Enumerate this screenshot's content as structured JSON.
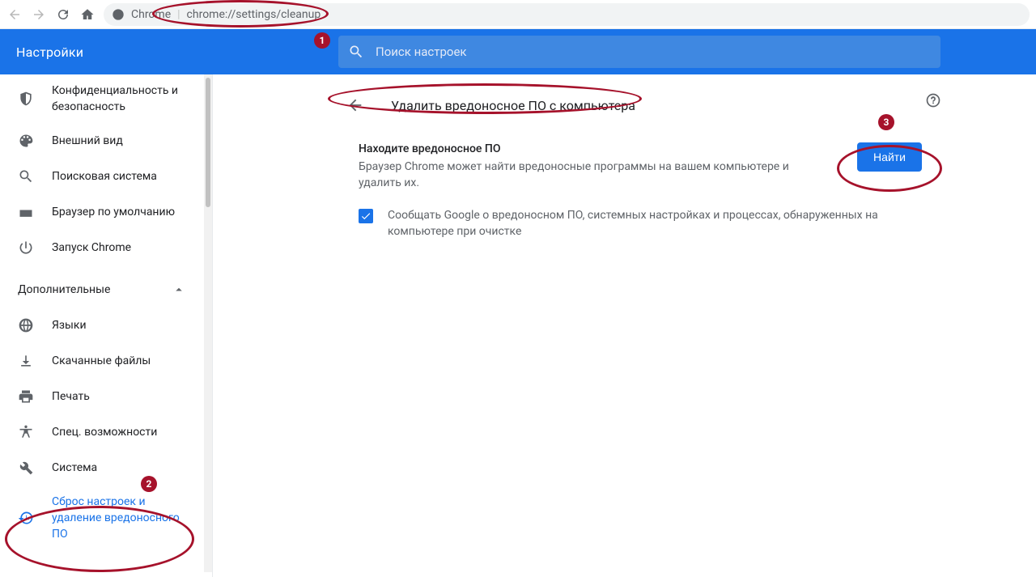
{
  "toolbar": {
    "url_prefix": "Chrome",
    "url_sep": "|",
    "url_rest": "chrome://settings/cleanup"
  },
  "header": {
    "title": "Настройки",
    "search_placeholder": "Поиск настроек"
  },
  "sidebar": {
    "items": [
      {
        "icon": "shield-icon",
        "label": "Конфиденциальность и безопасность"
      },
      {
        "icon": "palette-icon",
        "label": "Внешний вид"
      },
      {
        "icon": "search-icon",
        "label": "Поисковая система"
      },
      {
        "icon": "browser-icon",
        "label": "Браузер по умолчанию"
      },
      {
        "icon": "power-icon",
        "label": "Запуск Chrome"
      }
    ],
    "advanced_label": "Дополнительные",
    "adv_items": [
      {
        "icon": "globe-icon",
        "label": "Языки"
      },
      {
        "icon": "download-icon",
        "label": "Скачанные файлы"
      },
      {
        "icon": "print-icon",
        "label": "Печать"
      },
      {
        "icon": "accessibility-icon",
        "label": "Спец. возможности"
      },
      {
        "icon": "wrench-icon",
        "label": "Система"
      },
      {
        "icon": "restore-icon",
        "label": "Сброс настроек и удаление вредоносного ПО"
      }
    ]
  },
  "main": {
    "page_title": "Удалить вредоносное ПО с компьютера",
    "section_title": "Находите вредоносное ПО",
    "section_desc": "Браузер Chrome может найти вредоносные программы на вашем компьютере и удалить их.",
    "find_button": "Найти",
    "checkbox_label": "Сообщать Google о вредоносном ПО, системных настройках и процессах, обнаруженных на компьютере при очистке"
  },
  "annotations": {
    "badge1": "1",
    "badge2": "2",
    "badge3": "3"
  }
}
